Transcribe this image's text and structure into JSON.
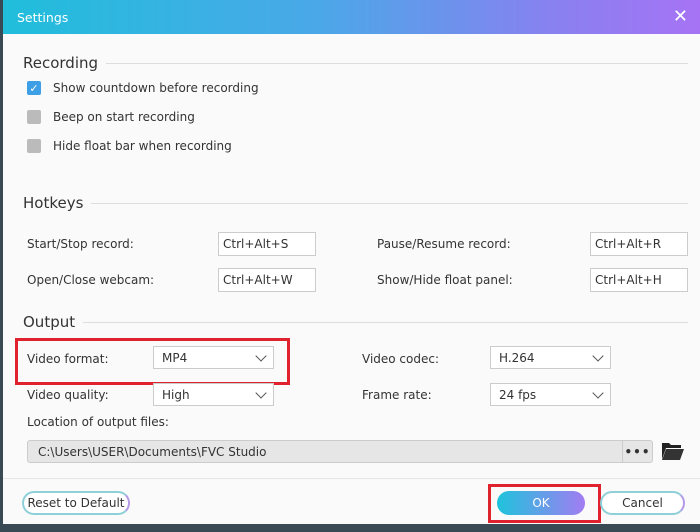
{
  "title": "Settings",
  "recording": {
    "heading": "Recording",
    "options": [
      {
        "label": "Show countdown before recording",
        "checked": true
      },
      {
        "label": "Beep on start recording",
        "checked": false
      },
      {
        "label": "Hide float bar when recording",
        "checked": false
      }
    ]
  },
  "hotkeys": {
    "heading": "Hotkeys",
    "start_stop": {
      "label": "Start/Stop record:",
      "value": "Ctrl+Alt+S"
    },
    "pause_resume": {
      "label": "Pause/Resume record:",
      "value": "Ctrl+Alt+R"
    },
    "webcam": {
      "label": "Open/Close webcam:",
      "value": "Ctrl+Alt+W"
    },
    "float_panel": {
      "label": "Show/Hide float panel:",
      "value": "Ctrl+Alt+H"
    }
  },
  "output": {
    "heading": "Output",
    "video_format": {
      "label": "Video format:",
      "value": "MP4"
    },
    "video_codec": {
      "label": "Video codec:",
      "value": "H.264"
    },
    "video_quality": {
      "label": "Video quality:",
      "value": "High"
    },
    "frame_rate": {
      "label": "Frame rate:",
      "value": "24 fps"
    },
    "location_label": "Location of output files:",
    "location": "C:\\Users\\USER\\Documents\\FVC Studio",
    "browse": "•••"
  },
  "footer": {
    "reset": "Reset to Default",
    "ok": "OK",
    "cancel": "Cancel"
  },
  "colors": {
    "accent": "#3d9fe6",
    "highlight": "#e0212e"
  }
}
